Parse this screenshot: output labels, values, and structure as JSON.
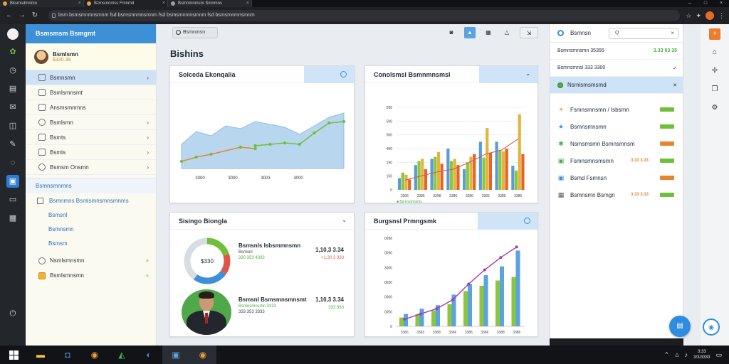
{
  "browser": {
    "tabs": [
      "Bksmsdmnmn",
      "Bzmsmnmss Fmnmd",
      "Bsmnmnmsm Smnmns"
    ],
    "url": "bsm bsmsmnmnsmnm fsd bsmsmnmnsmnm fsd bsmsmnmnsmnm fsd bsmsmnmnsmnm"
  },
  "sidebar": {
    "header": "Bsmsmsm Bsmgmt",
    "user_name": "Bsmlsmn",
    "user_sub": "$330.39",
    "items": [
      {
        "label": "Bsmnsmn",
        "chev": "›"
      },
      {
        "label": "Bsmlsmnsmt",
        "chev": ""
      },
      {
        "label": "Ansmsmnmns",
        "chev": ""
      },
      {
        "label": "Bsmlsmn",
        "chev": "›"
      },
      {
        "label": "Bsmts",
        "chev": "›"
      },
      {
        "label": "Bsmts",
        "chev": "›"
      },
      {
        "label": "Bsmsm Onsmn",
        "chev": "›"
      }
    ],
    "section": "Bsmnsmnmns",
    "section_check": "Bsmnmns Bsmlsmnsmnsmnms",
    "sub_items": [
      "Bsmsnl",
      "Bsmnsmn",
      "Bsmsm"
    ],
    "bottom_items": [
      "Nsmlsmnsmn",
      "Bsmlsmnsmn"
    ],
    "bottom_chev": "»"
  },
  "main": {
    "search": "Bsmnmsn",
    "page_title": "Bishins",
    "cards": [
      {
        "title": "Solceda Ekonqalia"
      },
      {
        "title": "Conolsmsl Bsmnmnsmsl"
      },
      {
        "title": "Sisingo Biongla"
      },
      {
        "title": "Burgsnsl Prmngsmk"
      }
    ]
  },
  "area_chart": {
    "x_ticks": [
      "3300",
      "3000",
      "3003",
      "3000"
    ]
  },
  "chart_data": [
    {
      "type": "area",
      "x": [
        0,
        1,
        2,
        3,
        4,
        5,
        6,
        7,
        8,
        9,
        10,
        11
      ],
      "area": [
        34,
        52,
        46,
        60,
        56,
        66,
        62,
        58,
        48,
        60,
        72,
        78
      ],
      "series": [
        {
          "name": "",
          "values": [
            10,
            16,
            20,
            null,
            30,
            28,
            null,
            null,
            null,
            null,
            null,
            null
          ],
          "color": "#e8852c"
        },
        {
          "name": "",
          "values": [
            null,
            null,
            null,
            null,
            null,
            32,
            34,
            36,
            34,
            50,
            64,
            66
          ],
          "color": "#6fbf3a"
        }
      ],
      "x_ticks": [
        "3300",
        "3000",
        "3003",
        "3000"
      ]
    },
    {
      "type": "bar",
      "categories": [
        "3306",
        "3386",
        "3398",
        "3386",
        "3386",
        "3383",
        "3386",
        "3386"
      ],
      "series": [
        {
          "name": "",
          "values": [
            17,
            36,
            45,
            60,
            30,
            70,
            70,
            35
          ],
          "color": "#5a9bd8"
        },
        {
          "name": "",
          "values": [
            25,
            42,
            48,
            42,
            40,
            47,
            58,
            28
          ],
          "color": "#8cc63f"
        },
        {
          "name": "",
          "values": [
            22,
            45,
            55,
            45,
            48,
            90,
            56,
            110
          ],
          "color": "#e2b53c"
        },
        {
          "name": "",
          "values": [
            15,
            30,
            38,
            36,
            52,
            54,
            60,
            52
          ],
          "color": "#e8632c"
        }
      ],
      "line": [
        14,
        20,
        26,
        30,
        40,
        52,
        58,
        74
      ],
      "y_ticks": [
        "0",
        "150",
        "190",
        "490",
        "500",
        "590",
        "590"
      ],
      "legend": "■ Bsmnsmnsms"
    },
    {
      "type": "pie",
      "center_label": "$330",
      "slices": [
        {
          "value": 20,
          "color": "#6fbf3a"
        },
        {
          "value": 15,
          "color": "#e0554b"
        },
        {
          "value": 25,
          "color": "#3d8fd6"
        },
        {
          "value": 40,
          "color": "#d8dde3"
        }
      ]
    },
    {
      "type": "bar",
      "categories": [
        "3366",
        "3363",
        "3368",
        "3366",
        "3386",
        "3366",
        "3388",
        "3386"
      ],
      "values": [
        10,
        14,
        18,
        25,
        40,
        46,
        52,
        56
      ],
      "values_blue": [
        14,
        20,
        24,
        36,
        48,
        58,
        68,
        86
      ],
      "line": [
        8,
        14,
        20,
        30,
        48,
        64,
        78,
        90
      ],
      "y_ticks": [
        "0",
        "0050",
        "0000",
        "0030",
        "3000",
        "0090",
        "0098"
      ]
    }
  ],
  "mini_list": [
    {
      "title": "Bsmsnls Isbsmmnsmn",
      "line1": "Bsmsnl",
      "line2": "330 353 4333",
      "val": "1,10,3 3.34",
      "neg": "+1.30 3 333",
      "pos": ""
    },
    {
      "title": "Bsmsnl Bsmsmnsmnsmt",
      "line1": "Bsmnsmnsmn 3333",
      "line2": "333 353 3333",
      "val": "1,10,3 3.34",
      "neg": "",
      "pos": "333 333"
    }
  ],
  "rpanel": {
    "label": "Bsmnsn",
    "search": "Q",
    "rows": [
      {
        "label": "Bsmnsmnsmn 35355",
        "val": "3.33 03 35"
      },
      {
        "label": "Bsmnsmnsl 333 3300",
        "val": "✓"
      },
      {
        "label": "Nsmlsmsmsmd",
        "val": "✕"
      }
    ],
    "list": [
      {
        "label": "Fsmnsmnsmn / Isbsmn",
        "mid": "",
        "bar": "#6fbf3a"
      },
      {
        "label": "Bsmnsmnsmn",
        "mid": "",
        "bar": "#6fbf3a"
      },
      {
        "label": "Nsmsmsmn Bsmnsmnsm",
        "mid": "",
        "bar": "#e8852c"
      },
      {
        "label": "Fsmnsmnsmsmn",
        "mid": "3.33 3.33",
        "bar": "#6fbf3a"
      },
      {
        "label": "Bsmd Fsmnsn",
        "mid": "",
        "bar": "#e8852c"
      },
      {
        "label": "Bsmnsmn Bsmgn",
        "mid": "3.33 3.33",
        "bar": "#6fbf3a"
      }
    ]
  },
  "tray": {
    "time": "3:33",
    "date": "3/3/3333"
  }
}
